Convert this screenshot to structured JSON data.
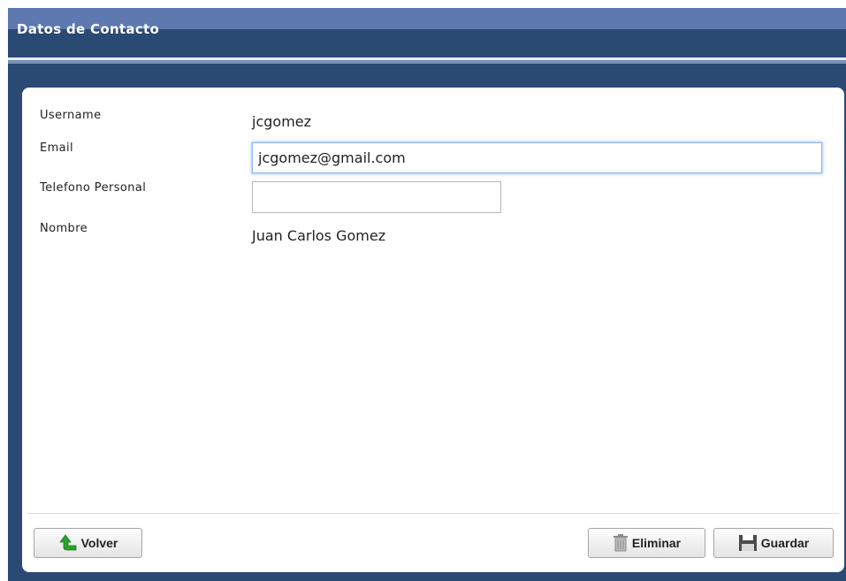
{
  "window": {
    "title": "Datos de Contacto"
  },
  "form": {
    "username": {
      "label": "Username",
      "value": "jcgomez"
    },
    "email": {
      "label": "Email",
      "value": "jcgomez@gmail.com"
    },
    "phone": {
      "label": "Telefono Personal",
      "value": "",
      "placeholder": ""
    },
    "name": {
      "label": "Nombre",
      "value": "Juan Carlos Gomez"
    }
  },
  "buttons": {
    "back": {
      "label": "Volver",
      "icon": "back-arrow-icon"
    },
    "delete": {
      "label": "Eliminar",
      "icon": "trash-icon"
    },
    "save": {
      "label": "Guardar",
      "icon": "floppy-disk-icon"
    }
  },
  "colors": {
    "title_bar": "#5d79b0",
    "window_background": "#2b4a73",
    "panel": "#ffffff",
    "focus_ring": "#8fb4e3",
    "back_arrow": "#2aa32a"
  }
}
